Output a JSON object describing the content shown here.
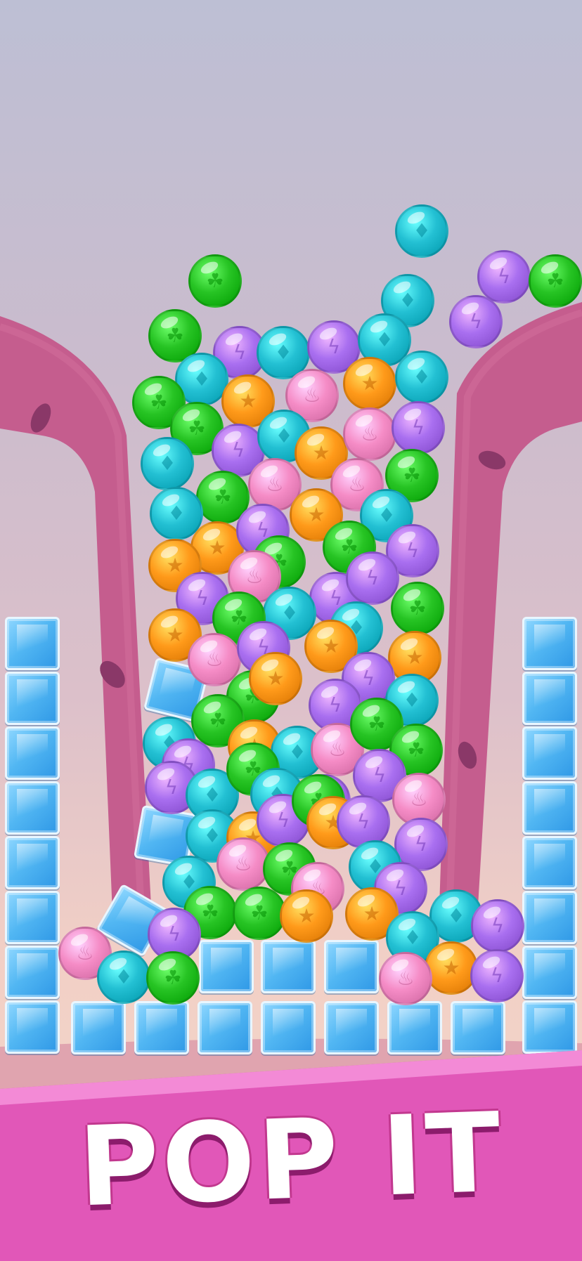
{
  "banner": {
    "title": "POP IT"
  },
  "colors": {
    "green": "#27c424",
    "teal": "#23c0d3",
    "purple": "#a96ff0",
    "pink": "#f58cc6",
    "orange": "#ff9a1a",
    "ice": "#4fb4f0",
    "banner": "#e45fbe",
    "tube": "#c95a8c"
  },
  "icons": {
    "green": "leaf-icon",
    "teal": "drop-icon",
    "purple": "bolt-icon",
    "pink": "flame-icon",
    "orange": "star-icon"
  }
}
